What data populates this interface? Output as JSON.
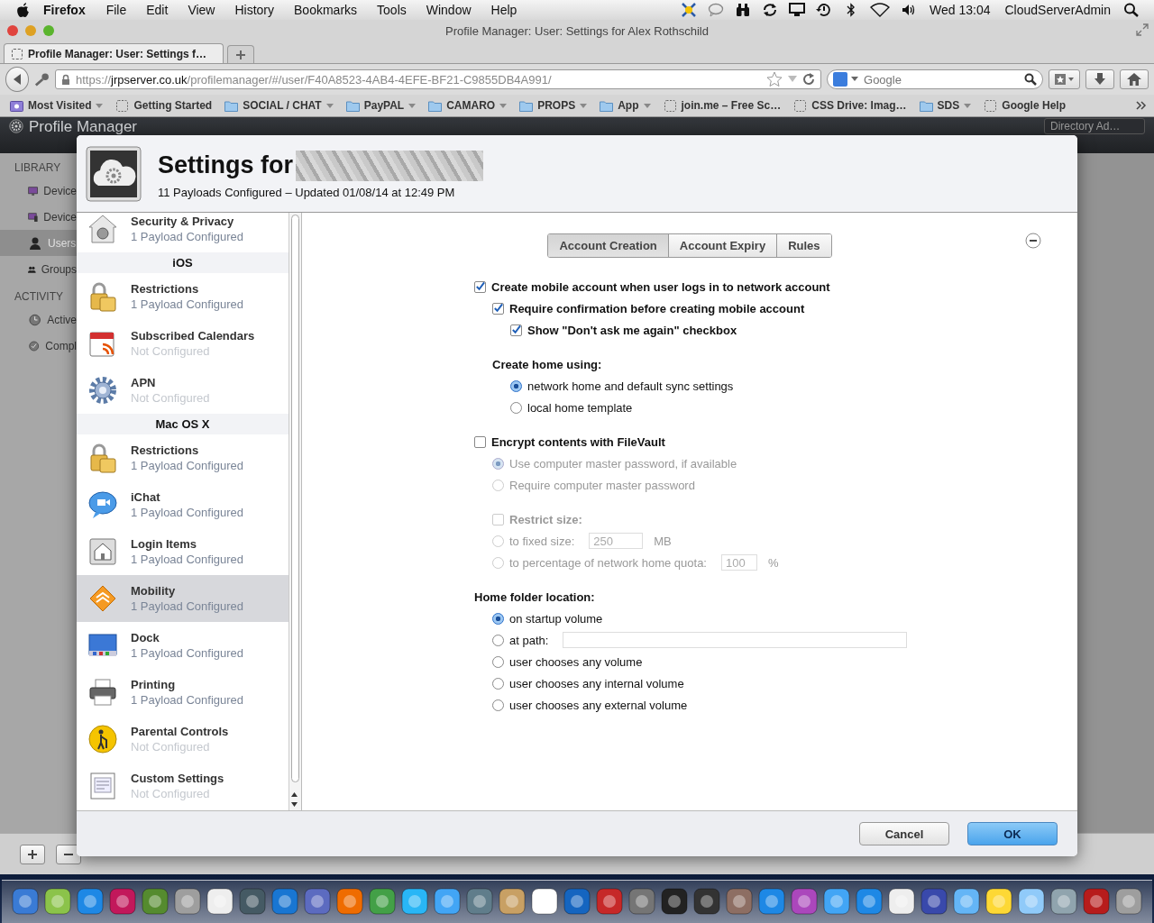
{
  "menubar": {
    "app": "Firefox",
    "menus": [
      "File",
      "Edit",
      "View",
      "History",
      "Bookmarks",
      "Tools",
      "Window",
      "Help"
    ],
    "clock": "Wed 13:04",
    "user": "CloudServerAdmin"
  },
  "window": {
    "title": "Profile Manager: User: Settings for Alex Rothschild"
  },
  "tabs": [
    {
      "label": "Profile Manager: User: Settings f…",
      "selected": true
    }
  ],
  "address": {
    "scheme": "https://",
    "host": "jrpserver.co.uk",
    "path": "/profilemanager/#/user/F40A8523-4AB4-4EFE-BF21-C9855DB4A991/"
  },
  "search": {
    "placeholder": "Google"
  },
  "bookmarks": [
    {
      "label": "Most Visited",
      "kind": "smart",
      "menu": true
    },
    {
      "label": "Getting Started",
      "kind": "page",
      "menu": false
    },
    {
      "label": "SOCIAL / CHAT",
      "kind": "folder",
      "menu": true
    },
    {
      "label": "PayPAL",
      "kind": "folder",
      "menu": true
    },
    {
      "label": "CAMARO",
      "kind": "folder",
      "menu": true
    },
    {
      "label": "PROPS",
      "kind": "folder",
      "menu": true
    },
    {
      "label": "App",
      "kind": "folder",
      "menu": true
    },
    {
      "label": "join.me – Free Sc…",
      "kind": "page",
      "menu": false
    },
    {
      "label": "CSS Drive: Imag…",
      "kind": "page",
      "menu": false
    },
    {
      "label": "SDS",
      "kind": "folder",
      "menu": true
    },
    {
      "label": "Google Help",
      "kind": "page",
      "menu": false
    }
  ],
  "app": {
    "title": "Profile Manager",
    "directory": "Directory Ad…",
    "sidebar": [
      {
        "title": "LIBRARY",
        "items": [
          {
            "label": "Device",
            "selected": false
          },
          {
            "label": "Device",
            "selected": false
          },
          {
            "label": "Users",
            "selected": true
          },
          {
            "label": "Groups",
            "selected": false
          }
        ]
      },
      {
        "title": "ACTIVITY",
        "items": [
          {
            "label": "Active",
            "selected": false
          },
          {
            "label": "Compl",
            "selected": false
          }
        ]
      }
    ]
  },
  "dialog": {
    "title": "Settings for",
    "subtitle": "11 Payloads Configured – Updated 01/08/14 at 12:49 PM",
    "payloads": [
      {
        "kind": "item",
        "title": "Security & Privacy",
        "status": "1 Payload Configured",
        "configured": true,
        "selected": false
      },
      {
        "kind": "section",
        "title": "iOS"
      },
      {
        "kind": "item",
        "title": "Restrictions",
        "status": "1 Payload Configured",
        "configured": true,
        "selected": false
      },
      {
        "kind": "item",
        "title": "Subscribed Calendars",
        "status": "Not Configured",
        "configured": false,
        "selected": false
      },
      {
        "kind": "item",
        "title": "APN",
        "status": "Not Configured",
        "configured": false,
        "selected": false
      },
      {
        "kind": "section",
        "title": "Mac OS X"
      },
      {
        "kind": "item",
        "title": "Restrictions",
        "status": "1 Payload Configured",
        "configured": true,
        "selected": false
      },
      {
        "kind": "item",
        "title": "iChat",
        "status": "1 Payload Configured",
        "configured": true,
        "selected": false
      },
      {
        "kind": "item",
        "title": "Login Items",
        "status": "1 Payload Configured",
        "configured": true,
        "selected": false
      },
      {
        "kind": "item",
        "title": "Mobility",
        "status": "1 Payload Configured",
        "configured": true,
        "selected": true
      },
      {
        "kind": "item",
        "title": "Dock",
        "status": "1 Payload Configured",
        "configured": true,
        "selected": false
      },
      {
        "kind": "item",
        "title": "Printing",
        "status": "1 Payload Configured",
        "configured": true,
        "selected": false
      },
      {
        "kind": "item",
        "title": "Parental Controls",
        "status": "Not Configured",
        "configured": false,
        "selected": false
      },
      {
        "kind": "item",
        "title": "Custom Settings",
        "status": "Not Configured",
        "configured": false,
        "selected": false
      }
    ],
    "tabs": [
      {
        "label": "Account Creation",
        "selected": true
      },
      {
        "label": "Account Expiry",
        "selected": false
      },
      {
        "label": "Rules",
        "selected": false
      }
    ],
    "options": [
      {
        "kind": "checkbox",
        "label": "Create mobile account when user logs in to network account",
        "checked": true,
        "disabled": false,
        "children": [
          {
            "kind": "checkbox",
            "label": "Require confirmation before creating mobile account",
            "checked": true,
            "disabled": false,
            "children": [
              {
                "kind": "checkbox",
                "label": "Show \"Don't ask me again\" checkbox",
                "checked": true,
                "disabled": false
              }
            ]
          },
          {
            "kind": "heading",
            "label": "Create home using:",
            "children": [
              {
                "kind": "radio",
                "label": "network home and default sync settings",
                "selected": true,
                "disabled": false
              },
              {
                "kind": "radio",
                "label": "local home template",
                "selected": false,
                "disabled": false
              }
            ]
          }
        ]
      },
      {
        "kind": "checkbox",
        "label": "Encrypt contents with FileVault",
        "checked": false,
        "disabled": false,
        "children": [
          {
            "kind": "radio",
            "label": "Use computer master password, if available",
            "selected": true,
            "disabled": true
          },
          {
            "kind": "radio",
            "label": "Require computer master password",
            "selected": false,
            "disabled": true
          },
          {
            "kind": "checkbox",
            "label": "Restrict size:",
            "checked": false,
            "disabled": true
          },
          {
            "kind": "radio",
            "label": "to fixed size:",
            "selected": false,
            "disabled": true,
            "value": "250",
            "unit": "MB"
          },
          {
            "kind": "radio",
            "label": "to percentage of network home quota:",
            "selected": false,
            "disabled": true,
            "value": "100",
            "unit": "%"
          }
        ]
      },
      {
        "kind": "heading",
        "label": "Home folder location:",
        "children": [
          {
            "kind": "radio",
            "label": "on startup volume",
            "selected": true,
            "disabled": false
          },
          {
            "kind": "path",
            "label": "at path:",
            "selected": false,
            "disabled": false
          },
          {
            "kind": "radio",
            "label": "user chooses any volume",
            "selected": false,
            "disabled": false
          },
          {
            "kind": "radio",
            "label": "user chooses any internal volume",
            "selected": false,
            "disabled": false
          },
          {
            "kind": "radio",
            "label": "user chooses any external volume",
            "selected": false,
            "disabled": false
          }
        ]
      }
    ],
    "buttons": [
      {
        "label": "Cancel",
        "default": false
      },
      {
        "label": "OK",
        "default": true
      }
    ]
  }
}
